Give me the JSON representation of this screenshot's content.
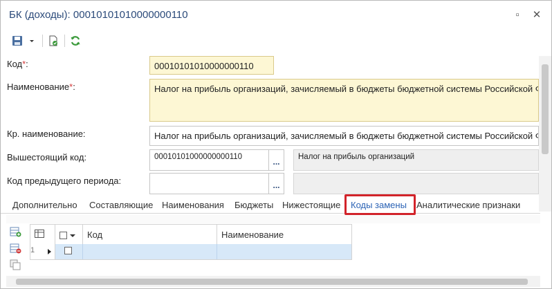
{
  "window": {
    "title": "БК (доходы): 00010101010000000110",
    "restore_glyph": "▫",
    "close_glyph": "✕"
  },
  "toolbar": {
    "save_icon": "floppy-disk-icon",
    "dropdown_icon": "chevron-down-icon",
    "doc_icon": "document-check-icon",
    "refresh_icon": "refresh-icon"
  },
  "form": {
    "code_label": "Код",
    "code_value": "00010101010000000110",
    "name_label": "Наименование",
    "name_value": "Налог на прибыль организаций, зачисляемый в бюджеты бюджетной системы Российской Федерации",
    "short_name_label": "Кр. наименование:",
    "short_name_value": "Налог на прибыль организаций, зачисляемый в бюджеты бюджетной системы Российской Федерации",
    "parent_code_label": "Вышестоящий код:",
    "parent_code_value": "00010101000000000110",
    "parent_code_name": "Налог на прибыль организаций",
    "prev_code_label": "Код предыдущего периода:",
    "prev_code_value": "",
    "prev_code_name": "",
    "dots_label": "..."
  },
  "tabs": [
    {
      "label": "Дополнительно"
    },
    {
      "label": "Составляющие"
    },
    {
      "label": "Наименования"
    },
    {
      "label": "Бюджеты"
    },
    {
      "label": "Нижестоящие"
    },
    {
      "label": "Коды замены"
    },
    {
      "label": "Аналитические признаки"
    }
  ],
  "grid": {
    "columns": [
      "Код",
      "Наименование"
    ],
    "rows": [
      {
        "num": "1",
        "code": "",
        "name": ""
      }
    ]
  },
  "colors": {
    "accent": "#2b63b5",
    "highlight": "#d2232a",
    "required_bg": "#fdf7d4",
    "row_selected": "#d7e8f8"
  }
}
